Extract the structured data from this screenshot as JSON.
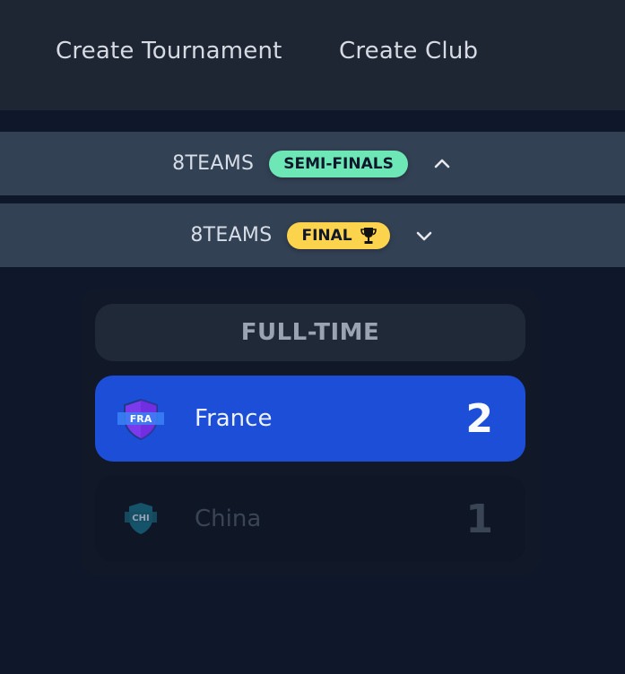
{
  "nav": {
    "create_tournament": "Create Tournament",
    "create_club": "Create Club"
  },
  "rounds": [
    {
      "title": "8TEAMS",
      "badge": "SEMI-FINALS",
      "badge_color": "#6ee7b7",
      "expanded": true,
      "chevron_icon": "chevron-up-icon"
    },
    {
      "title": "8TEAMS",
      "badge": "FINAL",
      "badge_color": "#fcd34d",
      "badge_icon": "trophy-icon",
      "expanded": false,
      "chevron_icon": "chevron-down-icon"
    }
  ],
  "match": {
    "status": "FULL-TIME",
    "home": {
      "abbr": "FRA",
      "name": "France",
      "score": "2",
      "winner": true,
      "accent": "#1d4ed8"
    },
    "away": {
      "abbr": "CHI",
      "name": "China",
      "score": "1",
      "winner": false
    }
  },
  "colors": {
    "background": "#0f172a",
    "nav_bg": "#1e2533",
    "round_band": "#334155",
    "winner_row": "#1d4ed8"
  }
}
